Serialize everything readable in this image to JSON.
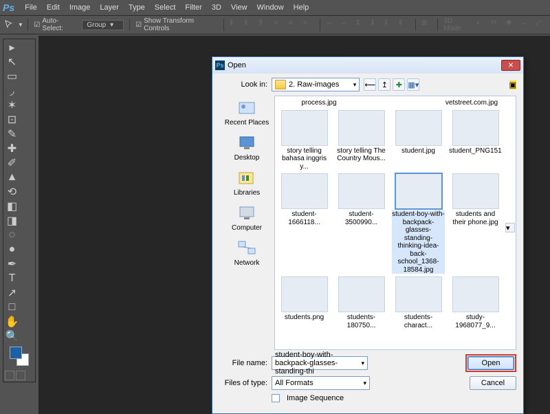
{
  "menubar": {
    "items": [
      "File",
      "Edit",
      "Image",
      "Layer",
      "Type",
      "Select",
      "Filter",
      "3D",
      "View",
      "Window",
      "Help"
    ]
  },
  "optionsbar": {
    "auto_select": "Auto-Select:",
    "group": "Group",
    "show_transform": "Show Transform Controls",
    "mode_3d": "3D Mode:"
  },
  "dialog": {
    "title": "Open",
    "look_in_label": "Look in:",
    "look_in_value": "2. Raw-images",
    "places": [
      "Recent Places",
      "Desktop",
      "Libraries",
      "Computer",
      "Network"
    ],
    "filename_label": "File name:",
    "filename_value": "student-boy-with-backpack-glasses-standing-thi",
    "filetype_label": "Files of type:",
    "filetype_value": "All Formats",
    "image_sequence": "Image Sequence",
    "open_btn": "Open",
    "cancel_btn": "Cancel",
    "header_row": [
      "process.jpg",
      "vetstreet.com.jpg"
    ],
    "files": [
      [
        {
          "cap": "story telling bahasa inggris y...",
          "cls": "th-a"
        },
        {
          "cap": "story telling The Country Mous...",
          "cls": "th-b"
        },
        {
          "cap": "student.jpg",
          "cls": "th-d"
        },
        {
          "cap": "student_PNG151...",
          "cls": "th-e"
        }
      ],
      [
        {
          "cap": "student-1666118...",
          "cls": "th-c"
        },
        {
          "cap": "student-3500990...",
          "cls": "th-f"
        },
        {
          "cap": "student-boy-with-backpack-glasses-standing-thinking-idea-back-school_1368-18584.jpg",
          "cls": "th-h",
          "selected": true
        },
        {
          "cap": "students and their phone.jpg",
          "cls": "th-i"
        }
      ],
      [
        {
          "cap": "students.png",
          "cls": "th-j"
        },
        {
          "cap": "students-180750...",
          "cls": "th-g"
        },
        {
          "cap": "students-charact...",
          "cls": "th-l"
        },
        {
          "cap": "study-1968077_9...",
          "cls": "th-m"
        }
      ]
    ]
  }
}
